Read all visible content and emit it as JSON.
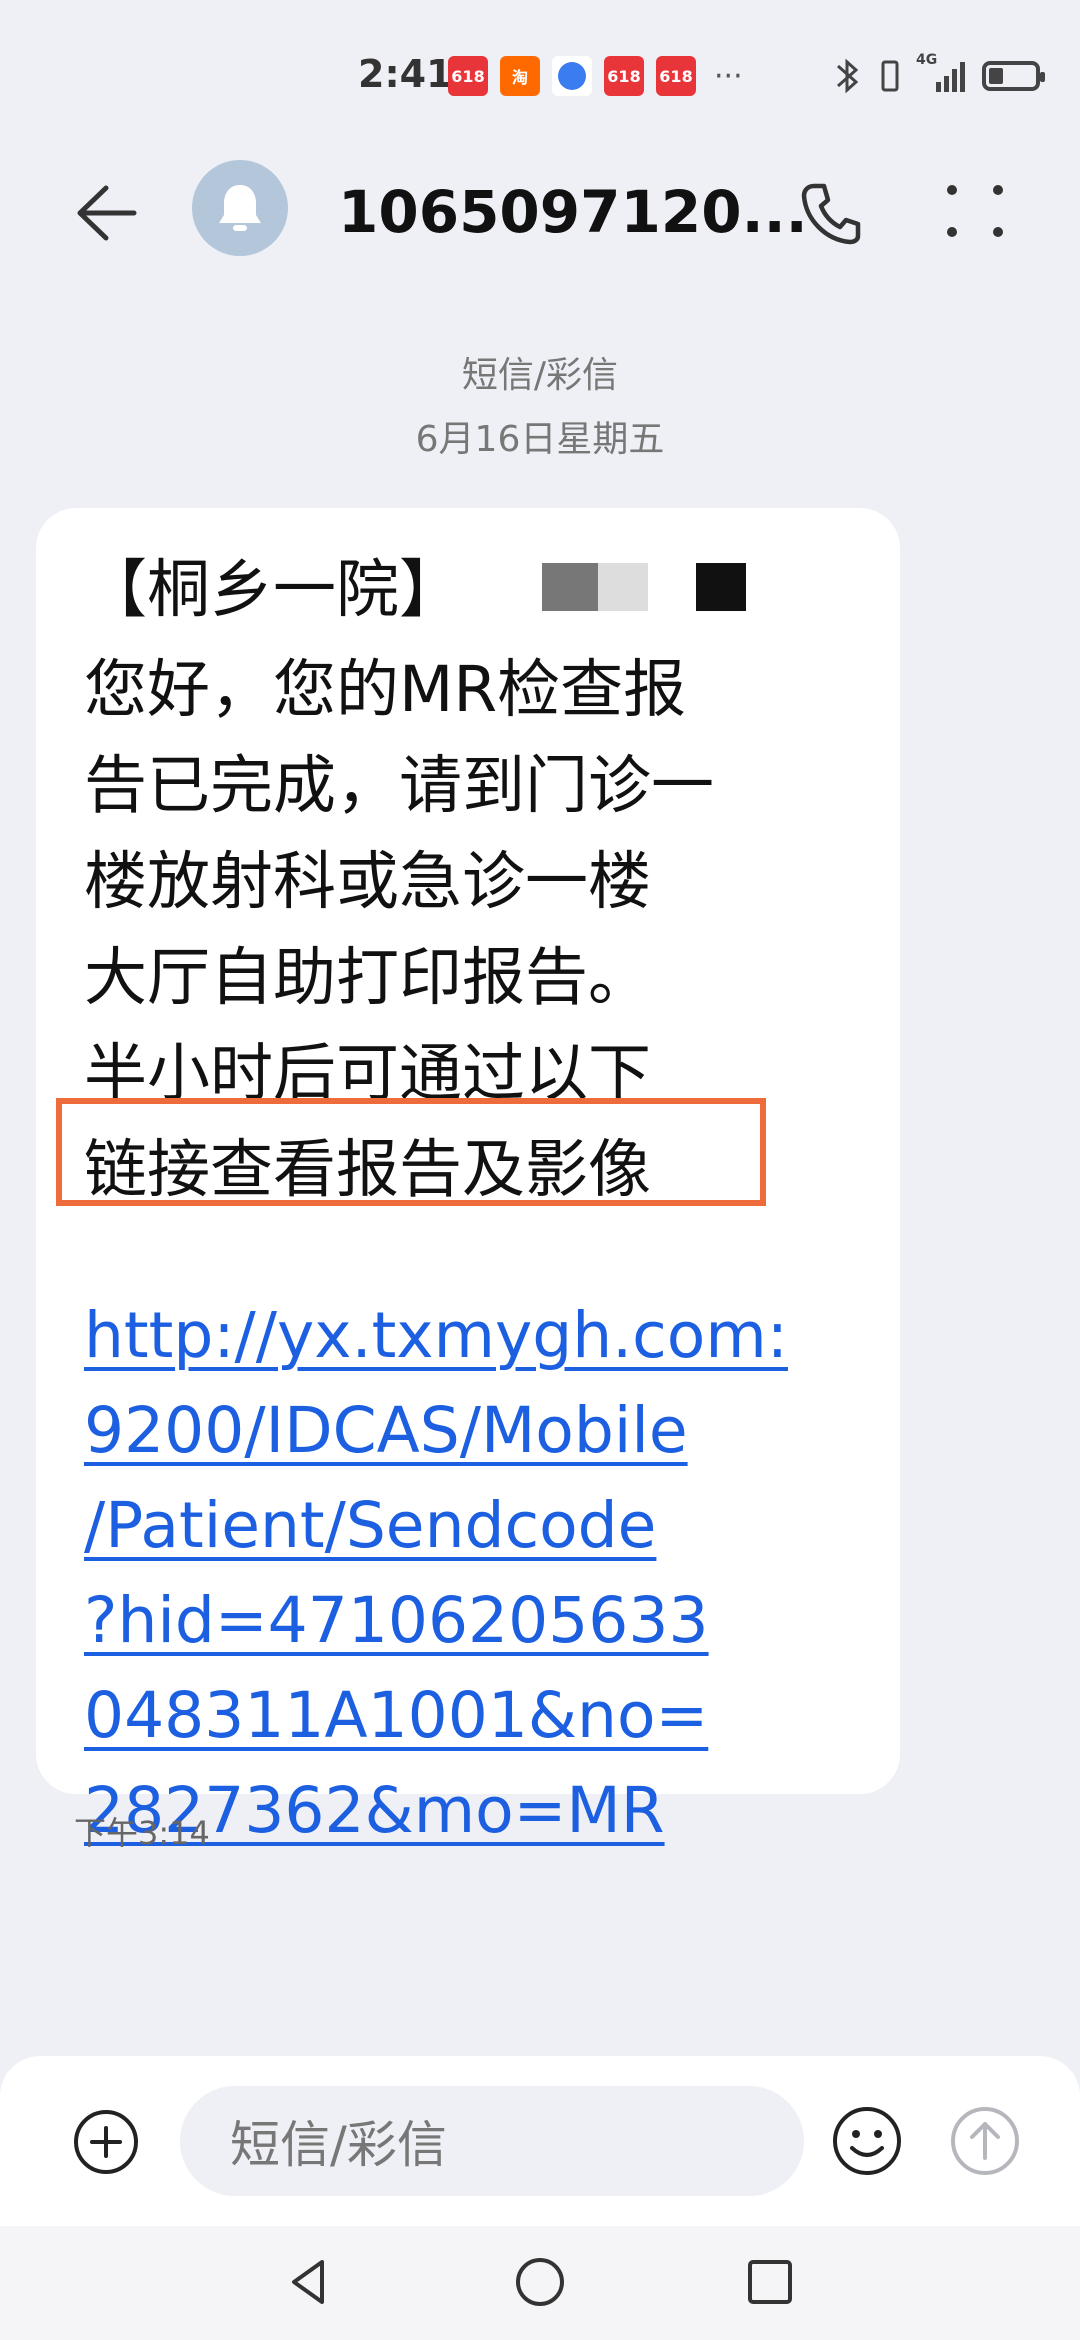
{
  "status_bar": {
    "time": "2:41",
    "notifications": [
      "618",
      "淘",
      "globe",
      "618",
      "618"
    ],
    "more": "···",
    "network": "4G"
  },
  "header": {
    "title": "1065097120...",
    "back_icon": "arrow-left-icon",
    "avatar_icon": "bell-icon",
    "call_icon": "phone-icon",
    "menu_icon": "more-vertical-icon"
  },
  "conversation": {
    "channel": "短信/彩信",
    "date": "6月16日星期五"
  },
  "message": {
    "lines": [
      "【桐乡一院】",
      "您好，您的MR检查报",
      "告已完成，请到门诊一",
      "楼放射科或急诊一楼",
      "大厅自助打印报告。",
      "半小时后可通过以下",
      "链接查看报告及影像"
    ],
    "link_lines": [
      "http://yx.txmygh.com:",
      "9200/IDCAS/Mobile",
      "/Patient/Sendcode",
      "?hid=47106205633",
      "048311A1001&no=",
      "2827362&mo=MR"
    ],
    "time": "下午3:14",
    "highlight_color": "#ee6c3c",
    "link_color": "#1c5fe0"
  },
  "composer": {
    "placeholder": "短信/彩信",
    "add_icon": "plus-circle-icon",
    "emoji_icon": "smiley-icon",
    "send_icon": "send-arrow-up-icon"
  },
  "nav": {
    "back_icon": "triangle-back-icon",
    "home_icon": "circle-home-icon",
    "recent_icon": "square-recents-icon"
  }
}
